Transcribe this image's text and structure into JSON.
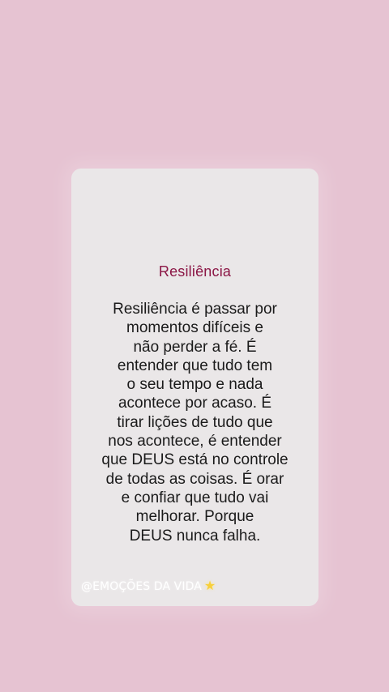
{
  "card": {
    "title": "Resiliência",
    "lines": [
      "Resiliência é passar por",
      "momentos difíceis e",
      "não perder a fé. É",
      "entender que tudo tem",
      "o seu tempo e nada",
      "acontece por acaso. É",
      "tirar lições de tudo que",
      "nos acontece, é entender",
      "que DEUS está no controle",
      "de todas as coisas. É orar",
      "e confiar que tudo vai",
      "melhorar. Porque",
      "DEUS nunca falha."
    ],
    "watermark": "@EMOÇÕES DA VIDA",
    "watermark_icon": "star-icon"
  },
  "colors": {
    "background": "#e6c3d2",
    "card": "#eae7e8",
    "title": "#8b1645",
    "text": "#1b1b1b"
  }
}
